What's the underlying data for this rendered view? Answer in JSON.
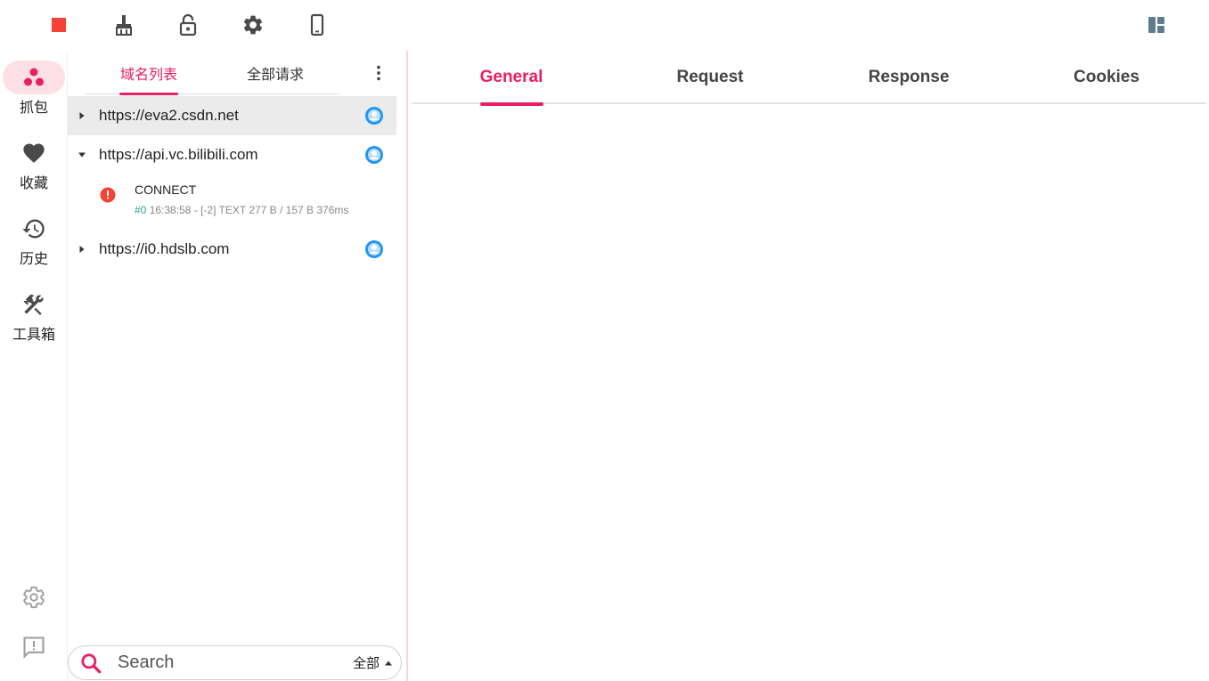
{
  "toolbar": {
    "stop_icon": "stop-icon",
    "clean_icon": "broom-icon",
    "lock_icon": "unlock-icon",
    "settings_icon": "gear-icon",
    "phone_icon": "phone-icon",
    "layout_icon": "layout-icon",
    "colors": {
      "stop": "#f44336",
      "icon": "#4a4a4a",
      "layout": "#607d8b"
    }
  },
  "rail": {
    "items": [
      {
        "label": "抓包",
        "icon": "capture-icon",
        "active": true
      },
      {
        "label": "收藏",
        "icon": "heart-icon",
        "active": false
      },
      {
        "label": "历史",
        "icon": "history-icon",
        "active": false
      },
      {
        "label": "工具箱",
        "icon": "tools-icon",
        "active": false
      }
    ],
    "bottom": [
      {
        "icon": "gear-icon"
      },
      {
        "icon": "feedback-icon"
      }
    ]
  },
  "panel": {
    "tabs": [
      {
        "label": "域名列表",
        "active": true
      },
      {
        "label": "全部请求",
        "active": false
      }
    ],
    "hosts": [
      {
        "url": "https://eva2.csdn.net",
        "expanded": false,
        "selected": true
      },
      {
        "url": "https://api.vc.bilibili.com",
        "expanded": true,
        "selected": false
      },
      {
        "url": "https://i0.hdslb.com",
        "expanded": false,
        "selected": false
      }
    ],
    "request": {
      "method": "CONNECT",
      "num": "#0",
      "meta": "16:38:58 - [-2]  TEXT 277 B / 157 B  376ms",
      "status": "error"
    },
    "search": {
      "placeholder": "Search",
      "filter": "全部"
    }
  },
  "detail": {
    "tabs": [
      {
        "label": "General",
        "active": true
      },
      {
        "label": "Request",
        "active": false
      },
      {
        "label": "Response",
        "active": false
      },
      {
        "label": "Cookies",
        "active": false
      }
    ]
  },
  "accent": "#e91e63"
}
